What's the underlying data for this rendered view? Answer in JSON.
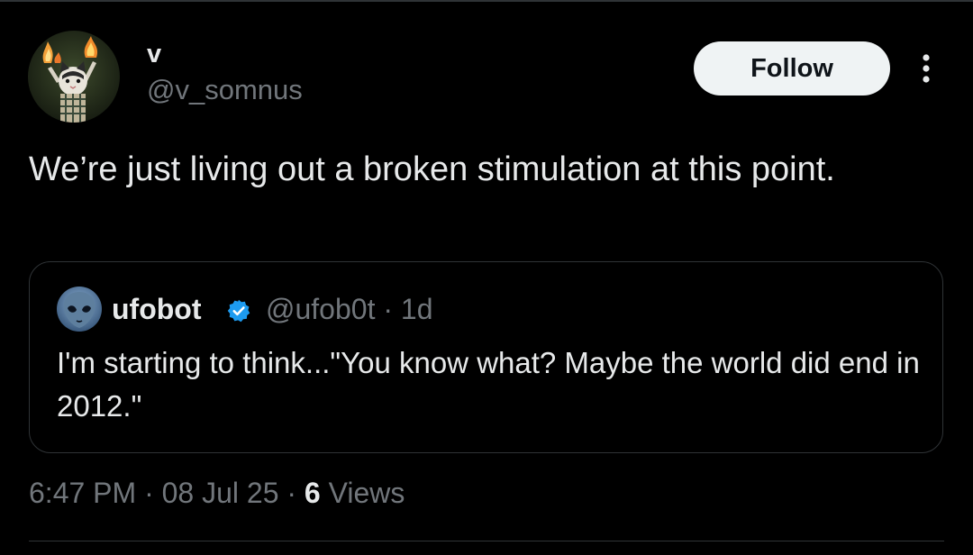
{
  "tweet": {
    "author": {
      "display_name": "v",
      "handle": "@v_somnus",
      "avatar_icon": "cat-with-fire-avatar-icon"
    },
    "follow_label": "Follow",
    "more_icon": "more-vertical-icon",
    "text": "We’re just living out a broken stimulation at this point.",
    "quoted": {
      "display_name": "ufobot",
      "verified": true,
      "verified_color": "#1d9bf0",
      "handle": "@ufob0t",
      "separator": "·",
      "age": "1d",
      "avatar_icon": "alien-avatar-icon",
      "text": "I'm starting to think...\"You know what? Maybe the world did end in 2012.\""
    },
    "meta": {
      "time": "6:47 PM",
      "separator": "·",
      "date": "08 Jul 25",
      "views_count": "6",
      "views_label": "Views"
    }
  },
  "colors": {
    "background": "#000000",
    "text_primary": "#e7e9ea",
    "text_secondary": "#71767b",
    "border": "#2f3336",
    "follow_bg": "#eff3f4"
  }
}
